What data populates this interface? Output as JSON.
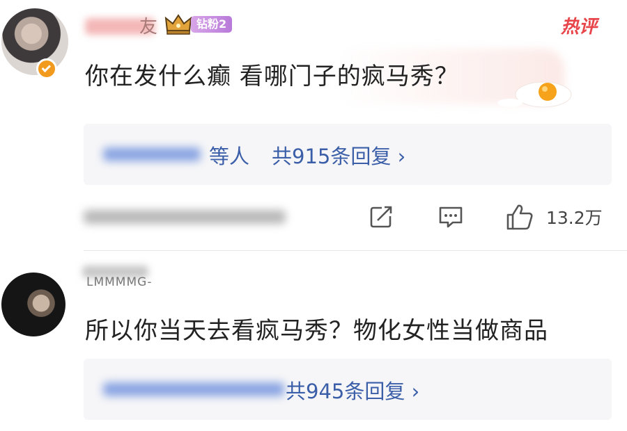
{
  "comments": [
    {
      "name_visible_tail": "友",
      "fan_badge": "钻粉2",
      "hot_label": "热评",
      "text": "你在发什么癫 看哪门子的疯马秀？",
      "reply_person_visible": "等人",
      "reply_count": "共915条回复 ›",
      "likes": "13.2万"
    },
    {
      "name_visible": "LMMMMG-",
      "text": "所以你当天去看疯马秀？物化女性当做商品",
      "reply_count": "共945条回复 ›"
    }
  ],
  "colors": {
    "link_blue": "#3b5ea8",
    "hot_red": "#e8454a",
    "verify_orange": "#f29a1e"
  }
}
